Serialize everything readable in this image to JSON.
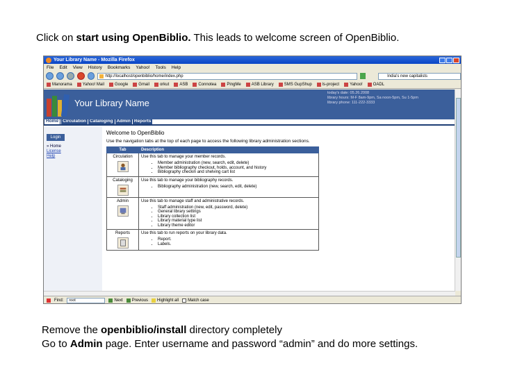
{
  "caption_top": {
    "pre": "Click on ",
    "bold": "start using OpenBiblio.",
    "post": " This leads to welcome screen of OpenBiblio."
  },
  "caption_bottom": {
    "line1_pre": "Remove the ",
    "line1_bold": "openbiblio/install",
    "line1_post": " directory completely",
    "line2_pre": "Go to ",
    "line2_bold": "Admin",
    "line2_post": " page. Enter username and password “admin” and do more settings."
  },
  "browser": {
    "title": "Your Library Name - Mozilla Firefox",
    "menu": [
      "File",
      "Edit",
      "View",
      "History",
      "Bookmarks",
      "Yahoo!",
      "Tools",
      "Help"
    ],
    "url": "http://localhost/openbiblio/home/index.php",
    "search": "India's new capitalists",
    "bookmarks": [
      "Manorama",
      "Yahoo! Mail",
      "Google",
      "Gmail",
      "orkut",
      "ASB",
      "Connotea",
      "PingMe",
      "ASB Library",
      "SMS GupShup",
      "ls-project",
      "Yahoo!",
      "OADL"
    ],
    "find": {
      "label": "Find:",
      "value": "root",
      "next": "Next",
      "previous": "Previous",
      "highlight": "Highlight all",
      "match_case": "Match case"
    }
  },
  "site": {
    "library_name": "Your Library Name",
    "info": [
      "today's date: 05.26.2008",
      "library hours: M-F 8am-9pm, Sa noon-5pm, Su 1-5pm",
      "library phone: 111-222-3333"
    ],
    "tabs": [
      "Home",
      "Circulation",
      "Cataloging",
      "Admin",
      "Reports"
    ],
    "login": "Login",
    "side_links": [
      "» Home",
      "License",
      "Help"
    ],
    "welcome": "Welcome to OpenBiblio",
    "intro": "Use the navigation tabs at the top of each page to access the following library administration sections.",
    "table_headers": [
      "Tab",
      "Description"
    ],
    "rows": [
      {
        "tab": "Circulation",
        "desc": "Use this tab to manage your member records.",
        "items": [
          "Member administration (new, search, edit, delete)",
          "Member bibliography checkout, holds, account, and history",
          "Bibliography checkin and shelving cart list"
        ]
      },
      {
        "tab": "Cataloging",
        "desc": "Use this tab to manage your bibliography records.",
        "items": [
          "Bibliography administration (new, search, edit, delete)"
        ]
      },
      {
        "tab": "Admin",
        "desc": "Use this tab to manage staff and administrative records.",
        "items": [
          "Staff administration (new, edit, password, delete)",
          "General library settings",
          "Library collection list",
          "Library material type list",
          "Library theme editor"
        ]
      },
      {
        "tab": "Reports",
        "desc": "Use this tab to run reports on your library data.",
        "items": [
          "Report.",
          "Labels."
        ]
      }
    ]
  }
}
